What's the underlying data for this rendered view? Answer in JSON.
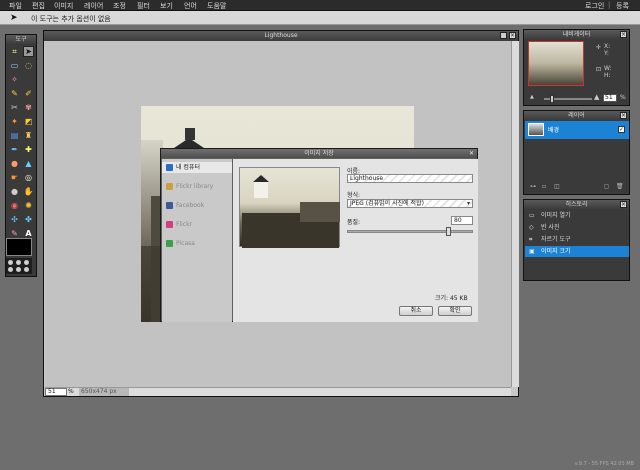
{
  "menu": {
    "items": [
      "파일",
      "편집",
      "이미지",
      "레이어",
      "조정",
      "필터",
      "보기",
      "언어",
      "도움말"
    ],
    "login": "로그인",
    "signup": "등록"
  },
  "options_bar": {
    "message": "이 도구는 추가 옵션이 없음"
  },
  "tools_panel": {
    "title": "도구"
  },
  "document": {
    "title": "Lighthouse",
    "zoom": "51",
    "zoom_unit": "%",
    "size_info": "650x474 px"
  },
  "dialog": {
    "title": "이미지 저장",
    "sources": [
      {
        "label": "내 컴퓨터",
        "selected": true,
        "color": "#2b6cc4"
      },
      {
        "label": "Flickr library",
        "selected": false,
        "color": "#c8a040"
      },
      {
        "label": "Facebook",
        "selected": false,
        "color": "#3b5998"
      },
      {
        "label": "Flickr",
        "selected": false,
        "color": "#d04080"
      },
      {
        "label": "Picasa",
        "selected": false,
        "color": "#3aa14a"
      }
    ],
    "name_label": "이름:",
    "name_value": "Lighthouse",
    "format_label": "형식:",
    "format_value": "JPEG (검퓨밝이 사진에 적합)",
    "quality_label": "품질:",
    "quality_value": "80",
    "size_text": "크기: 45 KB",
    "cancel_label": "취소",
    "ok_label": "확인"
  },
  "navigator": {
    "title": "내비게이터",
    "x_label": "X:",
    "y_label": "Y:",
    "w_label": "W:",
    "h_label": "H:",
    "zoom": "51",
    "zoom_unit": "%"
  },
  "layers": {
    "title": "레이어",
    "items": [
      {
        "name": "배경",
        "visible": true
      }
    ]
  },
  "history": {
    "title": "히스토리",
    "items": [
      {
        "label": "이미지 열기",
        "icon": "open-image-icon"
      },
      {
        "label": "빈 사진",
        "icon": "blank-photo-icon"
      },
      {
        "label": "자르기 도구",
        "icon": "crop-icon"
      },
      {
        "label": "이미지 크기",
        "icon": "resize-icon",
        "selected": true
      }
    ]
  },
  "footer": {
    "version": "v.9.7 - 55 FPS 42.03 MB"
  }
}
